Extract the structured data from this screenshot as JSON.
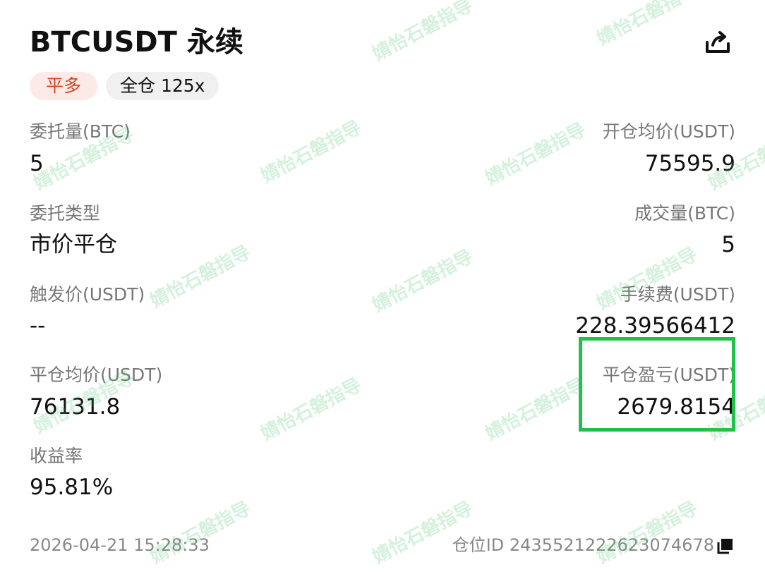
{
  "header": {
    "title": "BTCUSDT 永续",
    "share_icon": "share-icon"
  },
  "badges": {
    "side": "平多",
    "margin": "全仓 125x"
  },
  "fields": {
    "order_qty": {
      "label": "委托量(BTC)",
      "value": "5"
    },
    "open_avg_price": {
      "label": "开仓均价(USDT)",
      "value": "75595.9"
    },
    "order_type": {
      "label": "委托类型",
      "value": "市价平仓"
    },
    "filled_qty": {
      "label": "成交量(BTC)",
      "value": "5"
    },
    "trigger_price": {
      "label": "触发价(USDT)",
      "value": "--"
    },
    "fee": {
      "label": "手续费(USDT)",
      "value": "228.39566412"
    },
    "close_avg_price": {
      "label": "平仓均价(USDT)",
      "value": "76131.8"
    },
    "close_pnl": {
      "label": "平仓盈亏(USDT)",
      "value": "2679.8154"
    },
    "roi": {
      "label": "收益率",
      "value": "95.81%"
    }
  },
  "footer": {
    "time": "2026-04-21 15:28:33",
    "position_id": "仓位ID 2435521222623074678",
    "copy_icon": "copy-icon"
  },
  "watermark": "婧怡石磐指导",
  "colors": {
    "side_text": "#d8432a",
    "side_bg": "#fbeae6",
    "highlight": "#22c04a",
    "label": "#777777",
    "value": "#111111"
  }
}
